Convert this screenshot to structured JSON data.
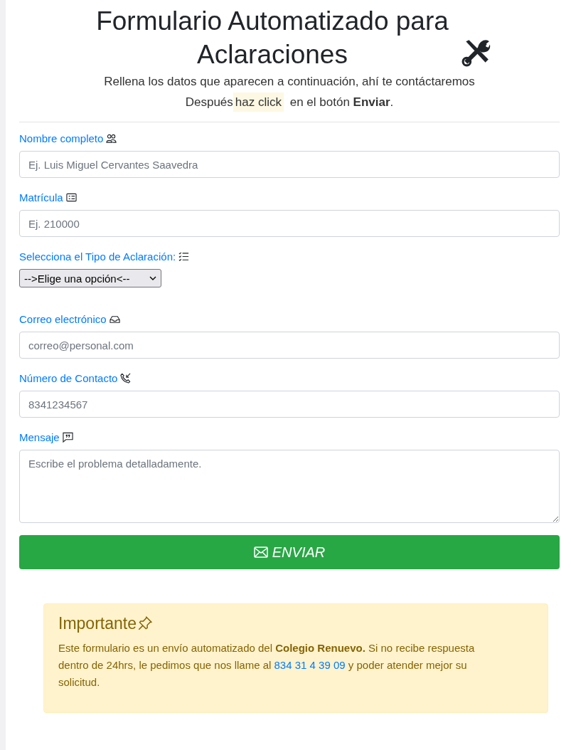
{
  "title": "Formulario Automatizado para Aclaraciones",
  "subtitle": {
    "line_1": "Rellena los datos que aparecen a continuación, ahí te contáctaremos",
    "line_2_before": "Después",
    "highlight": "haz click",
    "line_2_after": " en el botón **Enviar**."
  },
  "fields": [
    {
      "kind": "input",
      "label": "Nombre completo",
      "placeholder": "Ej. Luis Miguel Cervantes Saavedra"
    },
    {
      "kind": "input",
      "label": "Matrícula",
      "placeholder": "Ej. 210000"
    },
    {
      "kind": "select",
      "label": "Selecciona el Tipo de Aclaración:",
      "value": "-->Elige una opción<--"
    },
    {
      "kind": "input",
      "label": "Correo electrónico",
      "placeholder": "correo@personal.com"
    },
    {
      "kind": "input",
      "label": "Número de Contacto",
      "placeholder": "8341234567"
    },
    {
      "kind": "textarea",
      "label": "Mensaje",
      "placeholder": "Escribe el problema detalladamente."
    }
  ],
  "submit_button": "ENVIAR",
  "alert": {
    "heading": "Importante",
    "text_before": "Este formulario es un envío automatizado del **Colegio Renuevo.** Si no recibe respuesta dentro de 24hrs, le pedimos que nos llame al ",
    "phone_link": "834 31 4 39 09",
    "text_after": " y poder atender mejor su solicitud."
  }
}
